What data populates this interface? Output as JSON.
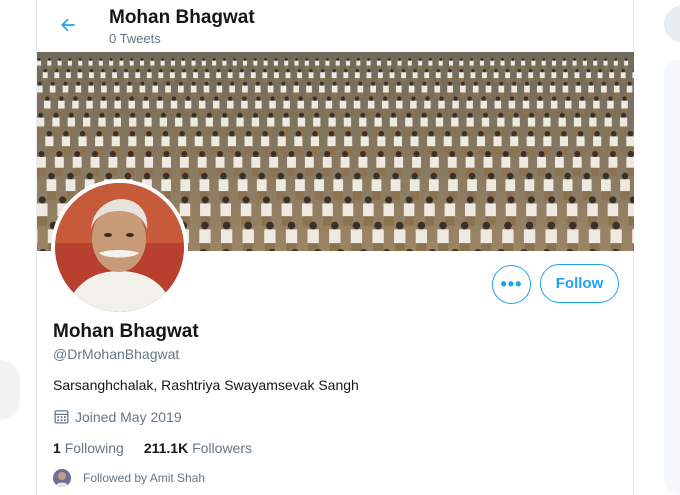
{
  "header": {
    "name": "Mohan Bhagwat",
    "tweet_count": "0 Tweets"
  },
  "actions": {
    "more_label": "•••",
    "follow_label": "Follow"
  },
  "profile": {
    "name": "Mohan Bhagwat",
    "handle": "@DrMohanBhagwat",
    "bio": "Sarsanghchalak, Rashtriya Swayamsevak Sangh",
    "joined": "Joined May 2019",
    "following_count": "1",
    "following_label": "Following",
    "followers_count": "211.1K",
    "followers_label": "Followers",
    "followed_by": "Followed by Amit Shah"
  },
  "colors": {
    "accent": "#1da1f2",
    "secondary_text": "#657786"
  },
  "icons": {
    "back": "back-arrow-icon",
    "calendar": "calendar-icon"
  }
}
